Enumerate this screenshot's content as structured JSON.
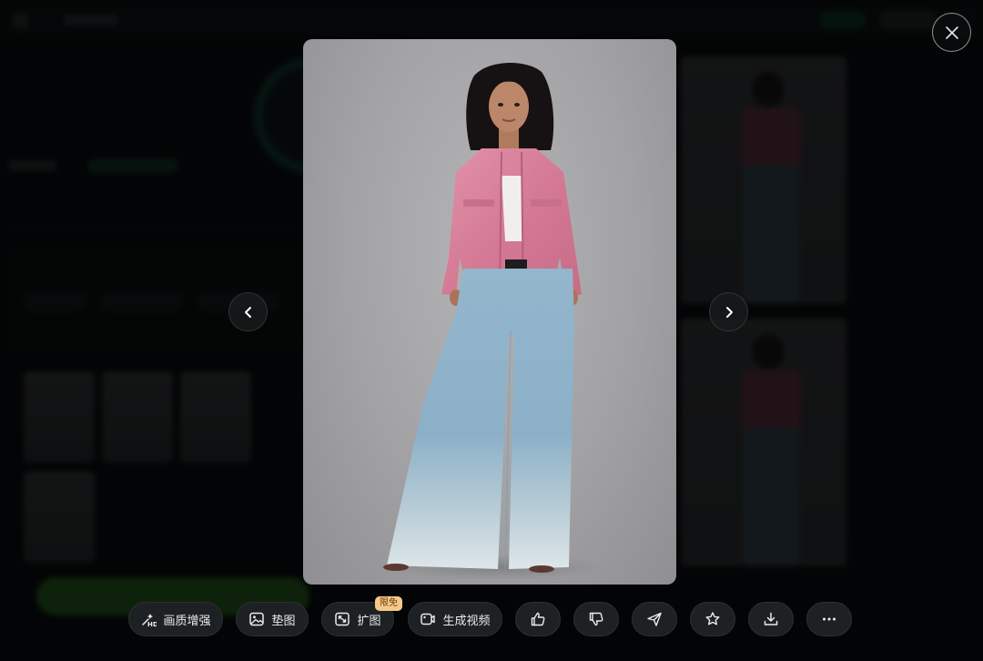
{
  "viewer": {
    "close_icon": "close-icon",
    "prev_icon": "chevron-left-icon",
    "next_icon": "chevron-right-icon",
    "image_subject": "model in pink denim jacket and light-blue wide-leg jeans"
  },
  "toolbar": {
    "enhance_label": "画质增强",
    "reference_label": "垫图",
    "expand_label": "扩图",
    "expand_badge": "限免",
    "video_label": "生成视频"
  },
  "colors": {
    "toolbar_bg": "#1e2123",
    "badge_bg": "#f5c98a",
    "jacket": "#d97e98",
    "jeans": "#8fb4cc"
  }
}
